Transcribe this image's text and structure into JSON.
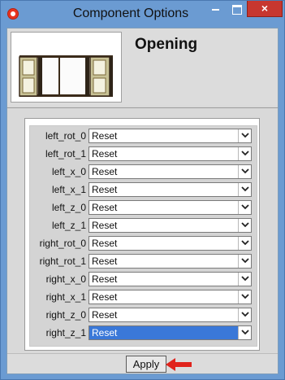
{
  "window": {
    "title": "Component Options",
    "close_glyph": "×"
  },
  "component": {
    "name": "Opening"
  },
  "options": [
    {
      "label": "left_rot_0",
      "value": "Reset"
    },
    {
      "label": "left_rot_1",
      "value": "Reset"
    },
    {
      "label": "left_x_0",
      "value": "Reset"
    },
    {
      "label": "left_x_1",
      "value": "Reset"
    },
    {
      "label": "left_z_0",
      "value": "Reset"
    },
    {
      "label": "left_z_1",
      "value": "Reset"
    },
    {
      "label": "right_rot_0",
      "value": "Reset"
    },
    {
      "label": "right_rot_1",
      "value": "Reset"
    },
    {
      "label": "right_x_0",
      "value": "Reset"
    },
    {
      "label": "right_x_1",
      "value": "Reset"
    },
    {
      "label": "right_z_0",
      "value": "Reset"
    },
    {
      "label": "right_z_1",
      "value": "Reset"
    }
  ],
  "footer": {
    "apply_label": "Apply"
  },
  "icons": {
    "app": "sketchup-icon",
    "minimize": "minimize-icon",
    "maximize": "maximize-icon",
    "close": "close-icon",
    "dropdown": "chevron-down-icon",
    "pointer": "red-arrow-icon"
  },
  "colors": {
    "titlebar": "#6b9bd2",
    "close_button": "#c7372f",
    "selection": "#3a78d8",
    "annotation_arrow": "#e0231c"
  }
}
